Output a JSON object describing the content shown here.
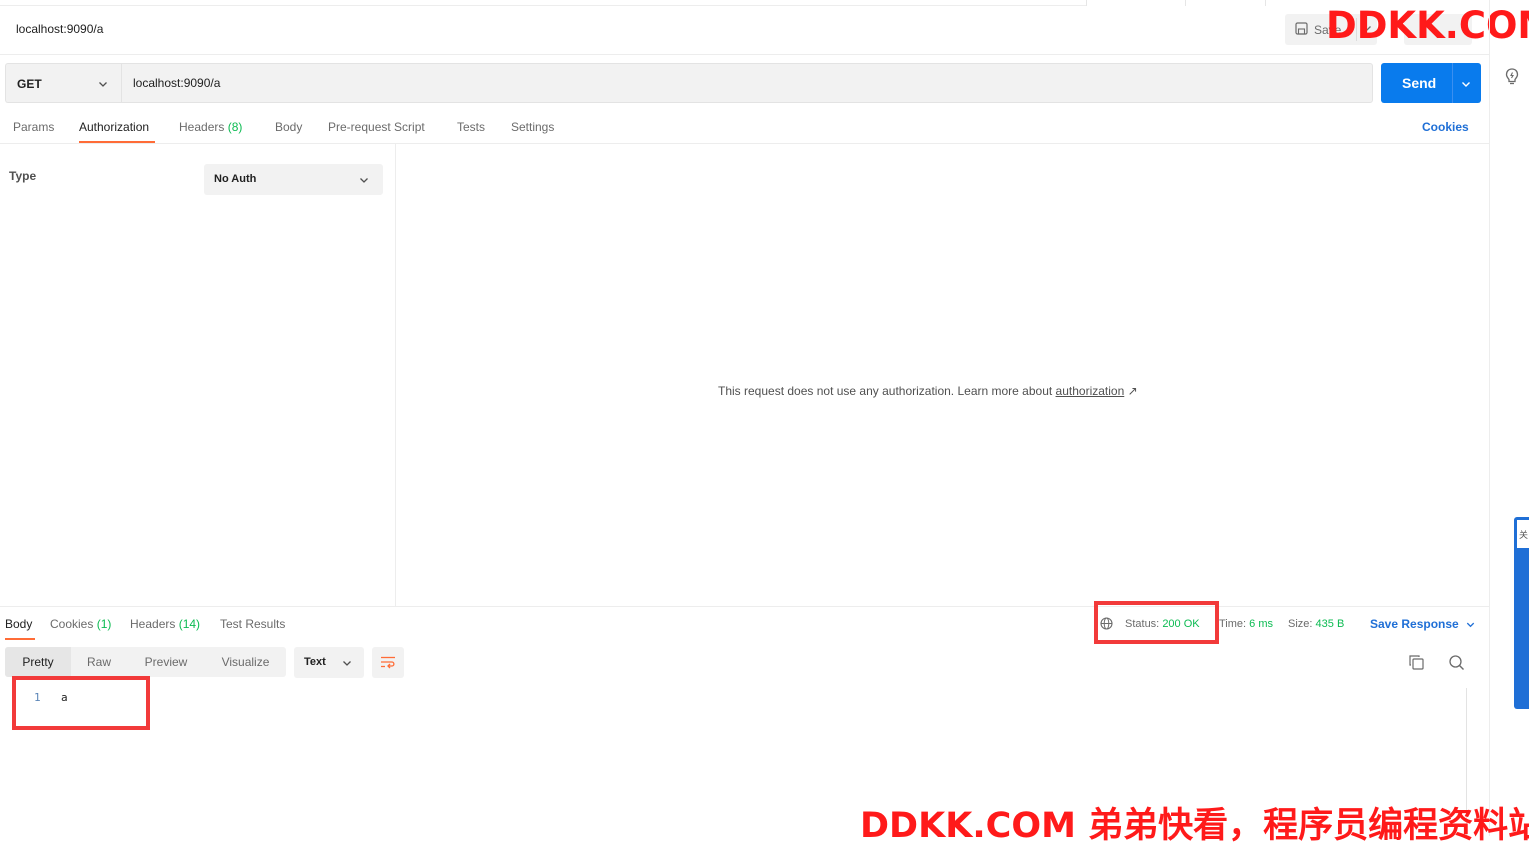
{
  "header": {
    "request_title": "localhost:9090/a",
    "save_label": "Save",
    "watermark": "DDKK.COM"
  },
  "request": {
    "method": "GET",
    "url": "localhost:9090/a",
    "send_label": "Send"
  },
  "request_tabs": {
    "params": "Params",
    "authorization": "Authorization",
    "headers_label": "Headers",
    "headers_count": "(8)",
    "body": "Body",
    "pre_request": "Pre-request Script",
    "tests": "Tests",
    "settings": "Settings",
    "cookies": "Cookies"
  },
  "auth": {
    "type_label": "Type",
    "type_value": "No Auth",
    "message": "This request does not use any authorization. Learn more about ",
    "link": "authorization",
    "link_arrow": "↗"
  },
  "response_tabs": {
    "body": "Body",
    "cookies_label": "Cookies",
    "cookies_count": "(1)",
    "headers_label": "Headers",
    "headers_count": "(14)",
    "test_results": "Test Results"
  },
  "response_meta": {
    "status_label": "Status:",
    "status_value": "200 OK",
    "time_label": "Time:",
    "time_value": "6 ms",
    "size_label": "Size:",
    "size_value": "435 B",
    "save_response": "Save Response"
  },
  "response_format": {
    "pretty": "Pretty",
    "raw": "Raw",
    "preview": "Preview",
    "visualize": "Visualize",
    "text_type": "Text"
  },
  "response_body": {
    "line_number": "1",
    "line_text": "a"
  },
  "side_widget_text": "关",
  "footer_watermark": "DDKK.COM 弟弟快看，程序员编程资料站",
  "colors": {
    "accent_orange": "#ff6c37",
    "send_blue": "#097bed",
    "link_blue": "#1f6fd6",
    "status_green": "#0cbb52",
    "highlight_red": "#f23a3a",
    "watermark_red": "#ff1a1a"
  }
}
